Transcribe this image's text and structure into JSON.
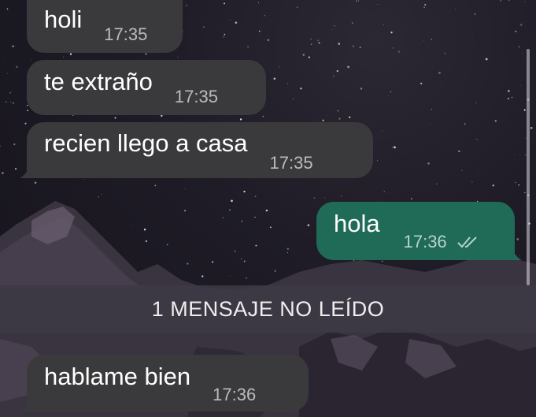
{
  "chat": {
    "messages": [
      {
        "direction": "incoming",
        "text": "holi",
        "time": "17:35"
      },
      {
        "direction": "incoming",
        "text": "te extraño",
        "time": "17:35"
      },
      {
        "direction": "incoming",
        "text": "recien llego a casa",
        "time": "17:35"
      },
      {
        "direction": "outgoing",
        "text": "hola",
        "time": "17:36",
        "status_icon": "double-check-icon"
      },
      {
        "direction": "incoming",
        "text": "hablame bien",
        "time": "17:36"
      }
    ],
    "unread_divider": "1 MENSAJE NO LEÍDO"
  },
  "colors": {
    "incoming_bubble": "#3a3a3c",
    "outgoing_bubble": "#1f6b57",
    "divider_bg": "#3e3a44"
  }
}
